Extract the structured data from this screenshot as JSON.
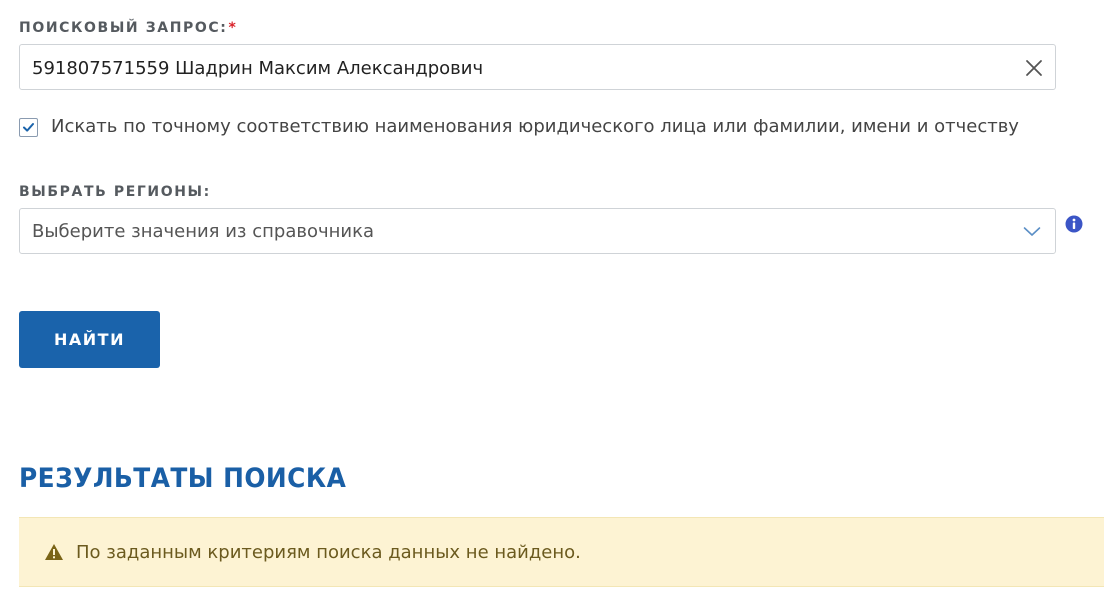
{
  "search": {
    "label": "ПОИСКОВЫЙ ЗАПРОС:",
    "required_mark": "*",
    "value": "591807571559 Шадрин Максим Александрович"
  },
  "exact_match": {
    "checked": true,
    "label": "Искать по точному соответствию наименования юридического лица или фамилии, имени и отчеству"
  },
  "regions": {
    "label": "ВЫБРАТЬ РЕГИОНЫ:",
    "placeholder": "Выберите значения из справочника"
  },
  "actions": {
    "find_label": "НАЙТИ"
  },
  "results": {
    "title": "РЕЗУЛЬТАТЫ ПОИСКА",
    "message": "По заданным критериям поиска данных не найдено."
  },
  "colors": {
    "accent": "#1a63ab",
    "title": "#1a5fa6",
    "required": "#d9222a",
    "alert_bg": "#fdf3d3",
    "alert_text": "#6b5a1e",
    "info_icon": "#3b55c6"
  },
  "icons": {
    "clear": "close-icon",
    "checkbox": "check-icon",
    "dropdown": "chevron-down-icon",
    "info": "info-icon",
    "alert": "warning-icon"
  }
}
